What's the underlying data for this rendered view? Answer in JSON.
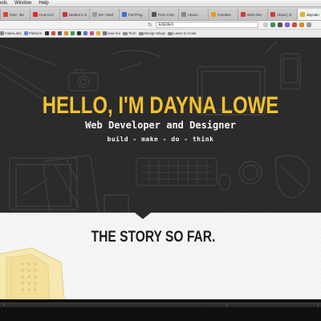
{
  "menubar": {
    "items": [
      "ools",
      "Window",
      "Help"
    ]
  },
  "tabs": [
    {
      "label": "html - Bo",
      "color": "#d24a3a",
      "active": false
    },
    {
      "label": "How to b",
      "color": "#e02a2a",
      "active": false
    },
    {
      "label": "Bedtox in 5 m",
      "color": "#cc3333",
      "active": false
    },
    {
      "label": "50+ Usef",
      "color": "#9a9a9a",
      "active": false
    },
    {
      "label": "Pat Prog",
      "color": "#3d6fd0",
      "active": false
    },
    {
      "label": "Pure CSS",
      "color": "#555555",
      "active": false
    },
    {
      "label": "About -",
      "color": "#888888",
      "active": false
    },
    {
      "label": "Creative",
      "color": "#e89a2a",
      "active": false
    },
    {
      "label": "Web Des",
      "color": "#cf3c3c",
      "active": false
    },
    {
      "label": "About | D",
      "color": "#cf3c3c",
      "active": false
    },
    {
      "label": "daynalo",
      "color": "#e0b030",
      "active": true
    }
  ],
  "addressbar": {
    "url": "E6E6E6"
  },
  "bookmarks": [
    {
      "label": "makeLabs",
      "color": "#888888"
    },
    {
      "label": "Platform",
      "color": "#6a8fd0"
    },
    {
      "label": "",
      "color": "#333333"
    },
    {
      "label": "",
      "color": "#d94a3a"
    },
    {
      "label": "",
      "color": "#555555"
    },
    {
      "label": "",
      "color": "#e08a2a"
    },
    {
      "label": "",
      "color": "#3a9a4a"
    },
    {
      "label": "",
      "color": "#333333"
    },
    {
      "label": "",
      "color": "#5a78c0"
    },
    {
      "label": "",
      "color": "#d84a8a"
    },
    {
      "label": "",
      "color": "#e0aa2a"
    },
    {
      "label": "read me",
      "color": "#777777"
    },
    {
      "label": "Tech",
      "color": "#8f8f8f",
      "folder": true
    },
    {
      "label": "Design Blogs",
      "color": "#8f8f8f",
      "folder": true
    },
    {
      "label": "Learn to Code",
      "color": "#8f8f8f",
      "folder": true
    }
  ],
  "hero": {
    "title": "HELLO, I'M DAYNA LOWE",
    "subtitle": "Web Developer and Designer",
    "tagline": "build - make - do - think"
  },
  "story": {
    "heading": "THE STORY SO FAR."
  },
  "colors": {
    "accent": "#f2c12e",
    "hero_bg": "#2b2b2b",
    "sketch_line": "#3d3d3d",
    "story_bg": "#f6f6f6"
  }
}
